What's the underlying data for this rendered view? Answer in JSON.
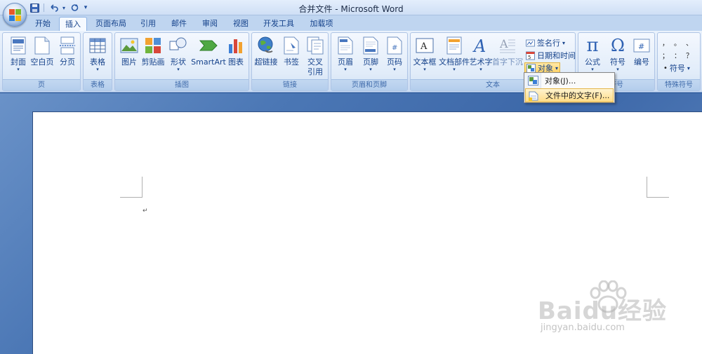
{
  "window": {
    "title": "合并文件 - Microsoft Word"
  },
  "qat": {
    "dropdown": "▾"
  },
  "tabs": [
    {
      "label": "开始"
    },
    {
      "label": "插入"
    },
    {
      "label": "页面布局"
    },
    {
      "label": "引用"
    },
    {
      "label": "邮件"
    },
    {
      "label": "审阅"
    },
    {
      "label": "视图"
    },
    {
      "label": "开发工具"
    },
    {
      "label": "加载项"
    }
  ],
  "ribbon": {
    "groups": {
      "pages": {
        "label": "页",
        "buttons": [
          {
            "label": "封面"
          },
          {
            "label": "空白页"
          },
          {
            "label": "分页"
          }
        ]
      },
      "tables": {
        "label": "表格",
        "buttons": [
          {
            "label": "表格"
          }
        ]
      },
      "illustrations": {
        "label": "插图",
        "buttons": [
          {
            "label": "图片"
          },
          {
            "label": "剪贴画"
          },
          {
            "label": "形状"
          },
          {
            "label": "SmartArt"
          },
          {
            "label": "图表"
          }
        ]
      },
      "links": {
        "label": "链接",
        "buttons": [
          {
            "label": "超链接"
          },
          {
            "label": "书签"
          },
          {
            "label": "交叉"
          },
          {
            "label": "引用"
          }
        ]
      },
      "header_footer": {
        "label": "页眉和页脚",
        "buttons": [
          {
            "label": "页眉"
          },
          {
            "label": "页脚"
          },
          {
            "label": "页码"
          }
        ]
      },
      "text": {
        "label": "文本",
        "buttons": [
          {
            "label": "文本框"
          },
          {
            "label": "文档部件"
          },
          {
            "label": "艺术字"
          },
          {
            "label": "首字下沉"
          }
        ],
        "small_buttons": [
          {
            "label": "签名行"
          },
          {
            "label": "日期和时间"
          },
          {
            "label": "对象"
          }
        ]
      },
      "symbols": {
        "label": "符号",
        "buttons": [
          {
            "label": "公式"
          },
          {
            "label": "符号"
          },
          {
            "label": "编号"
          }
        ]
      },
      "special": {
        "label": "特殊符号",
        "chars": [
          "，",
          "。",
          "、",
          "；",
          "：",
          "？"
        ],
        "button": "符号"
      }
    }
  },
  "dropdown": {
    "items": [
      {
        "label": "对象(J)..."
      },
      {
        "label": "文件中的文字(F)..."
      }
    ]
  },
  "document": {
    "paragraph_mark": "↵"
  },
  "watermark": {
    "text": "Baidu经验",
    "sub": "jingyan.baidu.com"
  },
  "colors": {
    "ribbon_bg": "#dce8f7",
    "accent": "#15428b",
    "highlight": "#ffd366",
    "doc_bg": "#4b77b5"
  }
}
